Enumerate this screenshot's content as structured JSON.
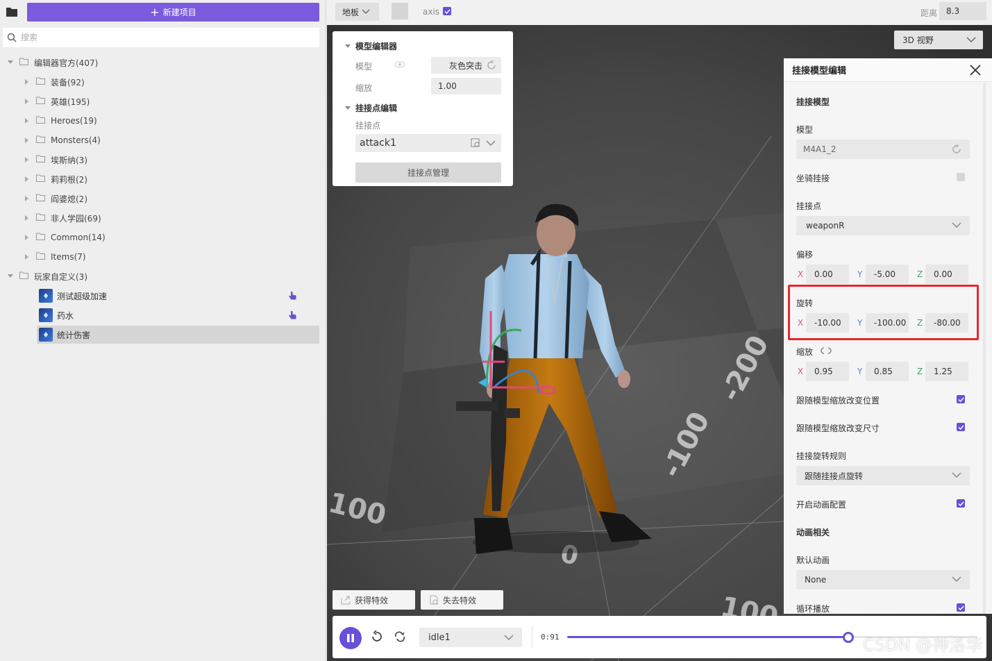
{
  "sidebar": {
    "new_button": "新建项目",
    "search_placeholder": "搜索",
    "tree": [
      {
        "label": "编辑器官方(407)"
      },
      {
        "label": "装备(92)"
      },
      {
        "label": "英雄(195)"
      },
      {
        "label": "Heroes(19)"
      },
      {
        "label": "Monsters(4)"
      },
      {
        "label": "埃斯纳(3)"
      },
      {
        "label": "莉莉根(2)"
      },
      {
        "label": "阎婆熄(2)"
      },
      {
        "label": "非人学园(69)"
      },
      {
        "label": "Common(14)"
      },
      {
        "label": "Items(7)"
      },
      {
        "label": "玩家自定义(3)"
      }
    ],
    "custom_items": [
      {
        "label": "测试超级加速"
      },
      {
        "label": "药水"
      },
      {
        "label": "统计伤害"
      }
    ]
  },
  "toolbar": {
    "ground": "地板",
    "axis_label": "axis",
    "axis_checked": true,
    "distance_label": "距离",
    "distance_value": "8.3"
  },
  "viewport": {
    "view_mode": "3D 视野",
    "grid_labels": [
      "-200",
      "-100",
      "100",
      "0",
      "100"
    ],
    "effect_gain": "获得特效",
    "effect_lose": "失去特效"
  },
  "model_editor": {
    "title": "模型编辑器",
    "model_label": "模型",
    "model_value": "灰色突击",
    "scale_label": "缩放",
    "scale_value": "1.00",
    "attach_section": "挂接点编辑",
    "attach_label": "挂接点",
    "attach_value": "attack1",
    "manage_button": "挂接点管理"
  },
  "attach_editor": {
    "title": "挂接模型编辑",
    "section_model": "挂接模型",
    "model_label": "模型",
    "model_value": "M4A1_2",
    "mount_label": "坐骑挂接",
    "point_label": "挂接点",
    "point_value": "weaponR",
    "offset_label": "偏移",
    "offset": {
      "x": "0.00",
      "y": "-5.00",
      "z": "0.00"
    },
    "rotation_label": "旋转",
    "rotation": {
      "x": "-10.00",
      "y": "-100.00",
      "z": "-80.00"
    },
    "scale_label": "缩放",
    "scale": {
      "x": "0.95",
      "y": "0.85",
      "z": "1.25"
    },
    "follow_pos_label": "跟随模型缩放改变位置",
    "follow_size_label": "跟随模型缩放改变尺寸",
    "rotate_rule_label": "挂接旋转规则",
    "rotate_rule_value": "跟随挂接点旋转",
    "anim_config_label": "开启动画配置",
    "anim_section": "动画相关",
    "default_anim_label": "默认动画",
    "default_anim_value": "None",
    "loop_label": "循环播放",
    "axis_names": {
      "x": "X",
      "y": "Y",
      "z": "Z"
    }
  },
  "timeline": {
    "animation": "idle1",
    "time": "0:91",
    "progress": 0.69
  },
  "watermark": "CSDN @神洛华",
  "colors": {
    "accent": "#6a4fd8",
    "highlight": "#e8262a",
    "axis_x": "#e2556e",
    "axis_y": "#4f88d6",
    "axis_z": "#3aa86a"
  }
}
